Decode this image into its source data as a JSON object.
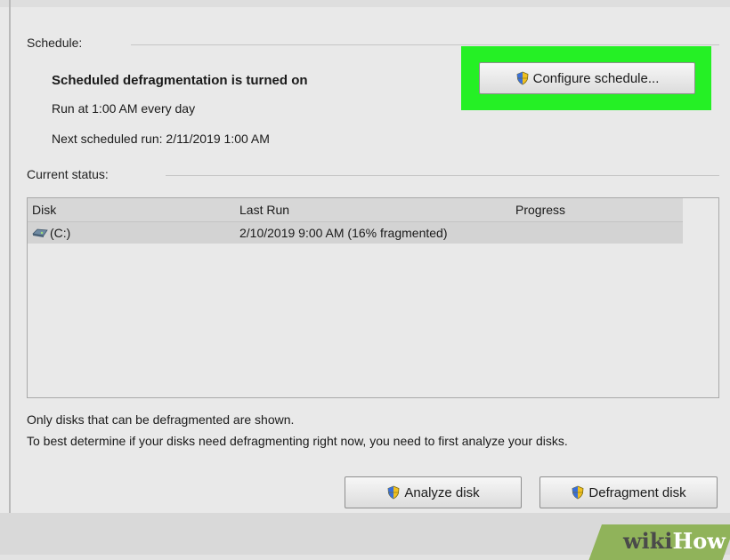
{
  "schedule": {
    "label": "Schedule:",
    "status": "Scheduled defragmentation is turned on",
    "run_at": "Run at 1:00 AM every day",
    "next_run": "Next scheduled run: 2/11/2019 1:00 AM",
    "configure_button": "Configure schedule..."
  },
  "current_status": {
    "label": "Current status:",
    "columns": [
      "Disk",
      "Last Run",
      "Progress"
    ],
    "rows": [
      {
        "disk": "(C:)",
        "last_run": "2/10/2019 9:00 AM (16% fragmented)",
        "progress": ""
      }
    ]
  },
  "notes": {
    "line1": "Only disks that can be defragmented are shown.",
    "line2": "To best determine if your disks need defragmenting right now, you need to first analyze your disks."
  },
  "actions": {
    "analyze": "Analyze disk",
    "defragment": "Defragment disk"
  },
  "watermark": {
    "wiki": "wiki",
    "how": "How"
  },
  "colors": {
    "highlight": "#25f025",
    "watermark_bg": "#90b35a"
  },
  "icons": {
    "shield": "uac-shield-icon",
    "disk": "drive-icon"
  }
}
